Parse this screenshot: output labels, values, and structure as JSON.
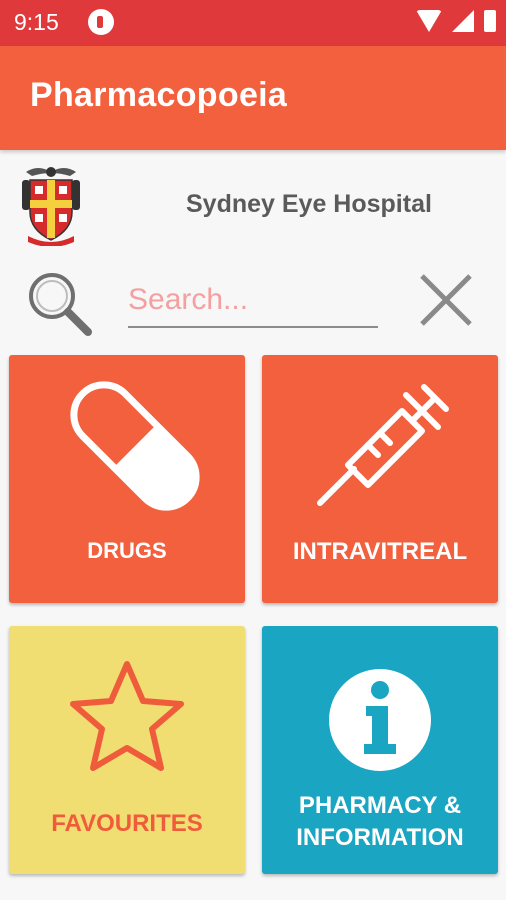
{
  "status_bar": {
    "time": "9:15",
    "icons": [
      "notification-icon",
      "wifi-icon",
      "signal-icon",
      "battery-icon"
    ]
  },
  "app_bar": {
    "title": "Pharmacopoeia"
  },
  "hospital": {
    "name": "Sydney Eye Hospital",
    "logo": "hospital-crest-icon"
  },
  "search": {
    "placeholder": "Search...",
    "value": ""
  },
  "tiles": [
    {
      "label": "DRUGS",
      "icon": "pill-icon",
      "color": "#f2603e"
    },
    {
      "label": "INTRAVITREAL",
      "icon": "syringe-icon",
      "color": "#f2603e"
    },
    {
      "label": "FAVOURITES",
      "icon": "star-icon",
      "color": "#f0de72"
    },
    {
      "label_line1": "PHARMACY &",
      "label_line2": "INFORMATION",
      "icon": "info-icon",
      "color": "#1aa5c3"
    }
  ],
  "colors": {
    "status_bar": "#e0393b",
    "app_bar": "#f2603e",
    "accent_text": "#ef5c3c"
  }
}
